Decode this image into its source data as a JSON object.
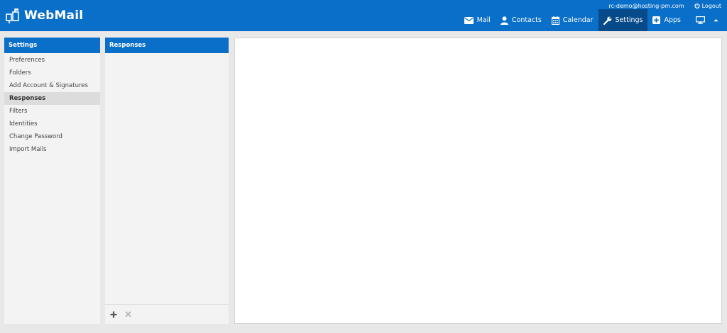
{
  "app": {
    "title": "WebMail"
  },
  "user": {
    "email": "rc-demo@hosting-pm.com",
    "logout_label": "Logout"
  },
  "taskbar": [
    {
      "label": "Mail",
      "icon": "envelope-icon"
    },
    {
      "label": "Contacts",
      "icon": "user-icon"
    },
    {
      "label": "Calendar",
      "icon": "calendar-icon"
    },
    {
      "label": "Settings",
      "icon": "wrench-icon",
      "active": true
    },
    {
      "label": "Apps",
      "icon": "plus-square-icon"
    }
  ],
  "settings_panel": {
    "header": "Settings",
    "items": [
      {
        "label": "Preferences"
      },
      {
        "label": "Folders"
      },
      {
        "label": "Add Account & Signatures"
      },
      {
        "label": "Responses",
        "selected": true
      },
      {
        "label": "Filters"
      },
      {
        "label": "Identities"
      },
      {
        "label": "Change Password"
      },
      {
        "label": "Import Mails"
      }
    ]
  },
  "responses_panel": {
    "header": "Responses"
  },
  "colors": {
    "brand": "#0a6fc9",
    "active": "#074a8a",
    "selected_row": "#dcdcdc"
  }
}
